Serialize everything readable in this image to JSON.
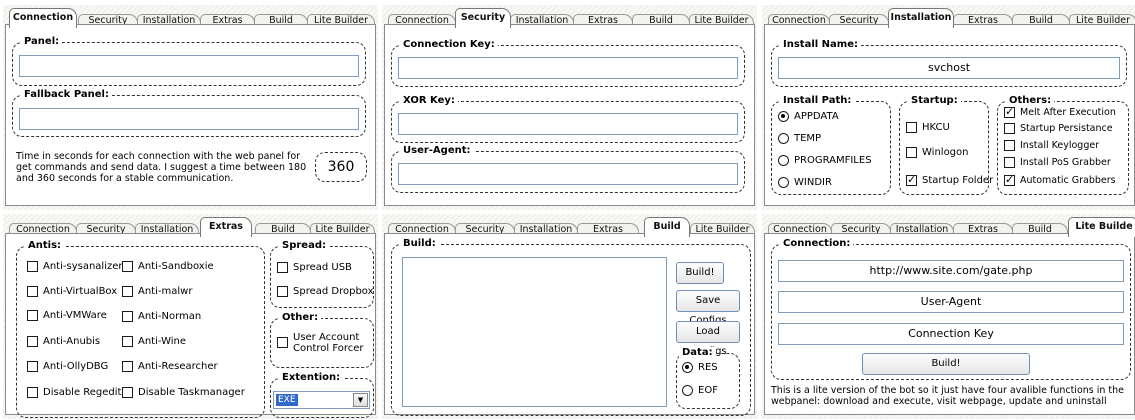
{
  "tabs": [
    "Connection",
    "Security",
    "Installation",
    "Extras",
    "Build",
    "Lite Builder"
  ],
  "connection": {
    "panel_label": "Panel:",
    "panel_value": "",
    "fallback_label": "Fallback Panel:",
    "fallback_value": "",
    "help_text": "Time in seconds for each connection with the web panel for get commands and send data. I suggest a time between 180 and 360 seconds for a stable communication.",
    "interval": "360"
  },
  "security": {
    "key_label": "Connection Key:",
    "xor_label": "XOR Key:",
    "ua_label": "User-Agent:",
    "key_value": "",
    "xor_value": "",
    "ua_value": ""
  },
  "installation": {
    "name_label": "Install Name:",
    "name_value": "svchost",
    "path_label": "Install Path:",
    "paths": [
      "APPDATA",
      "TEMP",
      "PROGRAMFILES",
      "WINDIR"
    ],
    "selected_path": "APPDATA",
    "startup_label": "Startup:",
    "startup": [
      {
        "label": "HKCU",
        "checked": false
      },
      {
        "label": "Winlogon",
        "checked": false
      },
      {
        "label": "Startup Folder",
        "checked": true
      }
    ],
    "others_label": "Others:",
    "others": [
      {
        "label": "Melt After Execution",
        "checked": true
      },
      {
        "label": "Startup Persistance",
        "checked": false
      },
      {
        "label": "Install Keylogger",
        "checked": false
      },
      {
        "label": "Install PoS Grabber",
        "checked": false
      },
      {
        "label": "Automatic Grabbers",
        "checked": true
      }
    ]
  },
  "extras": {
    "antis_label": "Antis:",
    "antis_left": [
      "Anti-sysanalizer",
      "Anti-VirtualBox",
      "Anti-VMWare",
      "Anti-Anubis",
      "Anti-OllyDBG",
      "Disable Regedit"
    ],
    "antis_right": [
      "Anti-Sandboxie",
      "Anti-malwr",
      "Anti-Norman",
      "Anti-Wine",
      "Anti-Researcher",
      "Disable Taskmanager"
    ],
    "spread_label": "Spread:",
    "spread": [
      "Spread USB",
      "Spread Dropbox"
    ],
    "other_label": "Other:",
    "other_line1": "User Account",
    "other_line2": "Control Forcer",
    "extention_label": "Extention:",
    "extention_value": "EXE"
  },
  "build": {
    "build_label": "Build:",
    "buttons": [
      "Build!",
      "Save Configs",
      "Load Configs"
    ],
    "data_label": "Data:",
    "data_options": [
      "RES",
      "EOF"
    ],
    "selected_data": "RES"
  },
  "lite": {
    "tab_label": "Lite Builde",
    "connection_label": "Connection:",
    "url": "http://www.site.com/gate.php",
    "user_agent": "User-Agent",
    "conn_key": "Connection Key",
    "build_button": "Build!",
    "note": "This is a lite version of the bot so it just have four avalible functions in the webpanel: download and execute, visit webpage, update and uninstall"
  }
}
